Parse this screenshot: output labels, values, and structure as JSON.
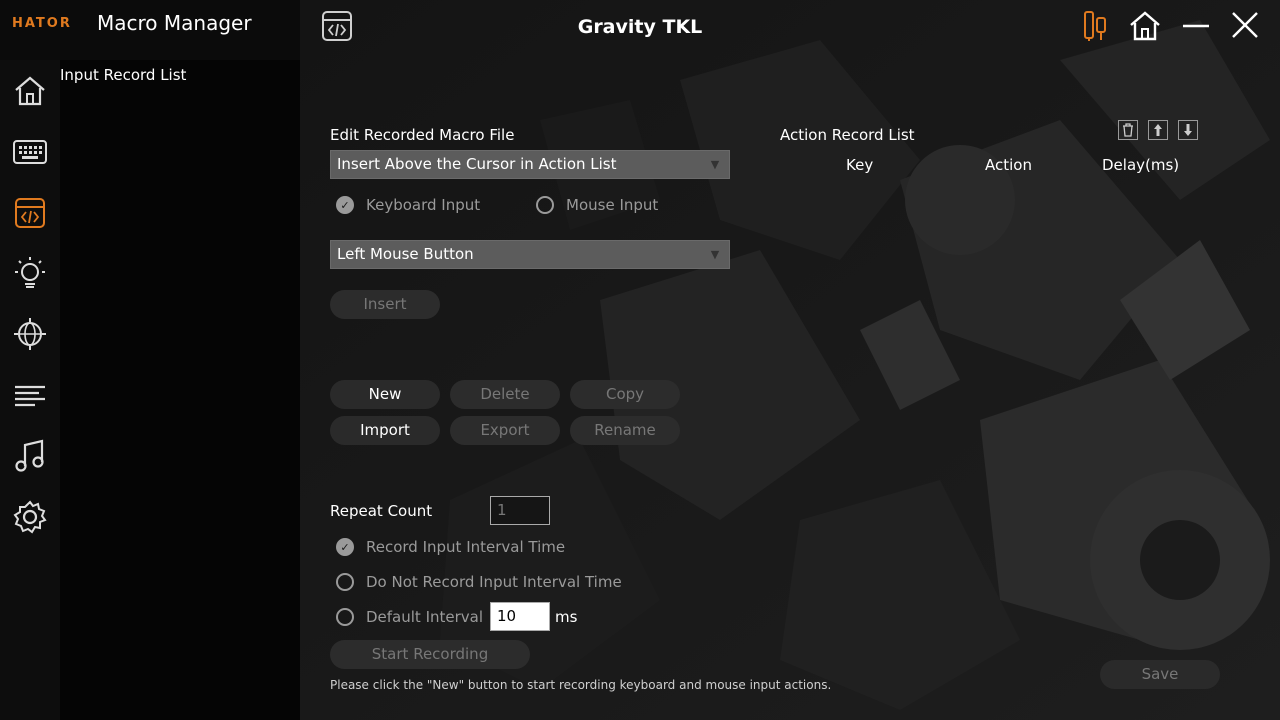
{
  "brand": "HATOR",
  "app_title": "Macro Manager",
  "device": "Gravity TKL",
  "sidebar": {
    "title": "Input Record List",
    "items": [
      "home",
      "keyboard",
      "macro",
      "lighting",
      "network",
      "list",
      "music",
      "settings"
    ]
  },
  "editor": {
    "section_title": "Edit Recorded Macro File",
    "insert_mode": "Insert Above the Cursor in Action List",
    "keyboard_input": "Keyboard Input",
    "mouse_input": "Mouse Input",
    "selected_key": "Left Mouse Button",
    "insert_button": "Insert"
  },
  "file_buttons": {
    "new": "New",
    "delete": "Delete",
    "copy": "Copy",
    "import": "Import",
    "export": "Export",
    "rename": "Rename"
  },
  "repeat": {
    "label": "Repeat Count",
    "value": "1",
    "record_interval": "Record Input Interval Time",
    "no_record_interval": "Do Not Record Input Interval Time",
    "default_interval": "Default Interval",
    "interval_value": "10",
    "unit": "ms"
  },
  "start_recording": "Start Recording",
  "hint": "Please click the \"New\" button to start recording keyboard and mouse input actions.",
  "action_list": {
    "title": "Action Record List",
    "columns": [
      "Key",
      "Action",
      "Delay(ms)"
    ]
  },
  "save": "Save",
  "colors": {
    "accent": "#e07a1f"
  }
}
